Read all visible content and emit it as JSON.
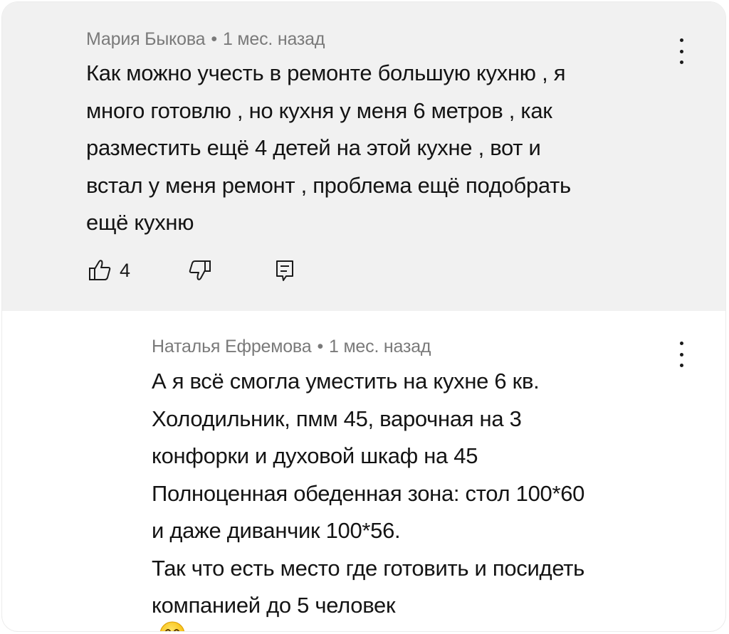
{
  "parent_comment": {
    "author": "Мария Быкова",
    "separator": "•",
    "time": "1 мес. назад",
    "lines": [
      "Как можно учесть в ремонте большую кухню , я",
      "много готовлю , но кухня у меня 6 метров , как",
      "разместить ещё 4 детей на этой кухне , вот и",
      "встал у меня ремонт , проблема ещё подобрать",
      "ещё кухню"
    ],
    "like_count": "4",
    "icons": {
      "like": "thumbs-up-icon",
      "dislike": "thumbs-down-icon",
      "reply": "reply-comment-icon",
      "menu": "more-vertical-icon"
    }
  },
  "reply_comment": {
    "author": "Наталья Ефремова",
    "separator": "•",
    "time": "1 мес. назад",
    "lines": [
      "А я всё смогла уместить на кухне 6 кв.",
      "Холодильник, пмм 45, варочная на 3",
      "конфорки и духовой шкаф на 45",
      "Полноценная обеденная зона: стол 100*60",
      "и даже диванчик 100*56.",
      "Так что есть место где готовить и посидеть",
      "компанией до 5 человек"
    ],
    "emoji": "smiling-face-emoji",
    "icons": {
      "menu": "more-vertical-icon"
    }
  },
  "colors": {
    "parent_background": "#f1f1f1",
    "reply_background": "#ffffff",
    "meta_text": "#7a7a7a",
    "body_text": "#141414"
  }
}
